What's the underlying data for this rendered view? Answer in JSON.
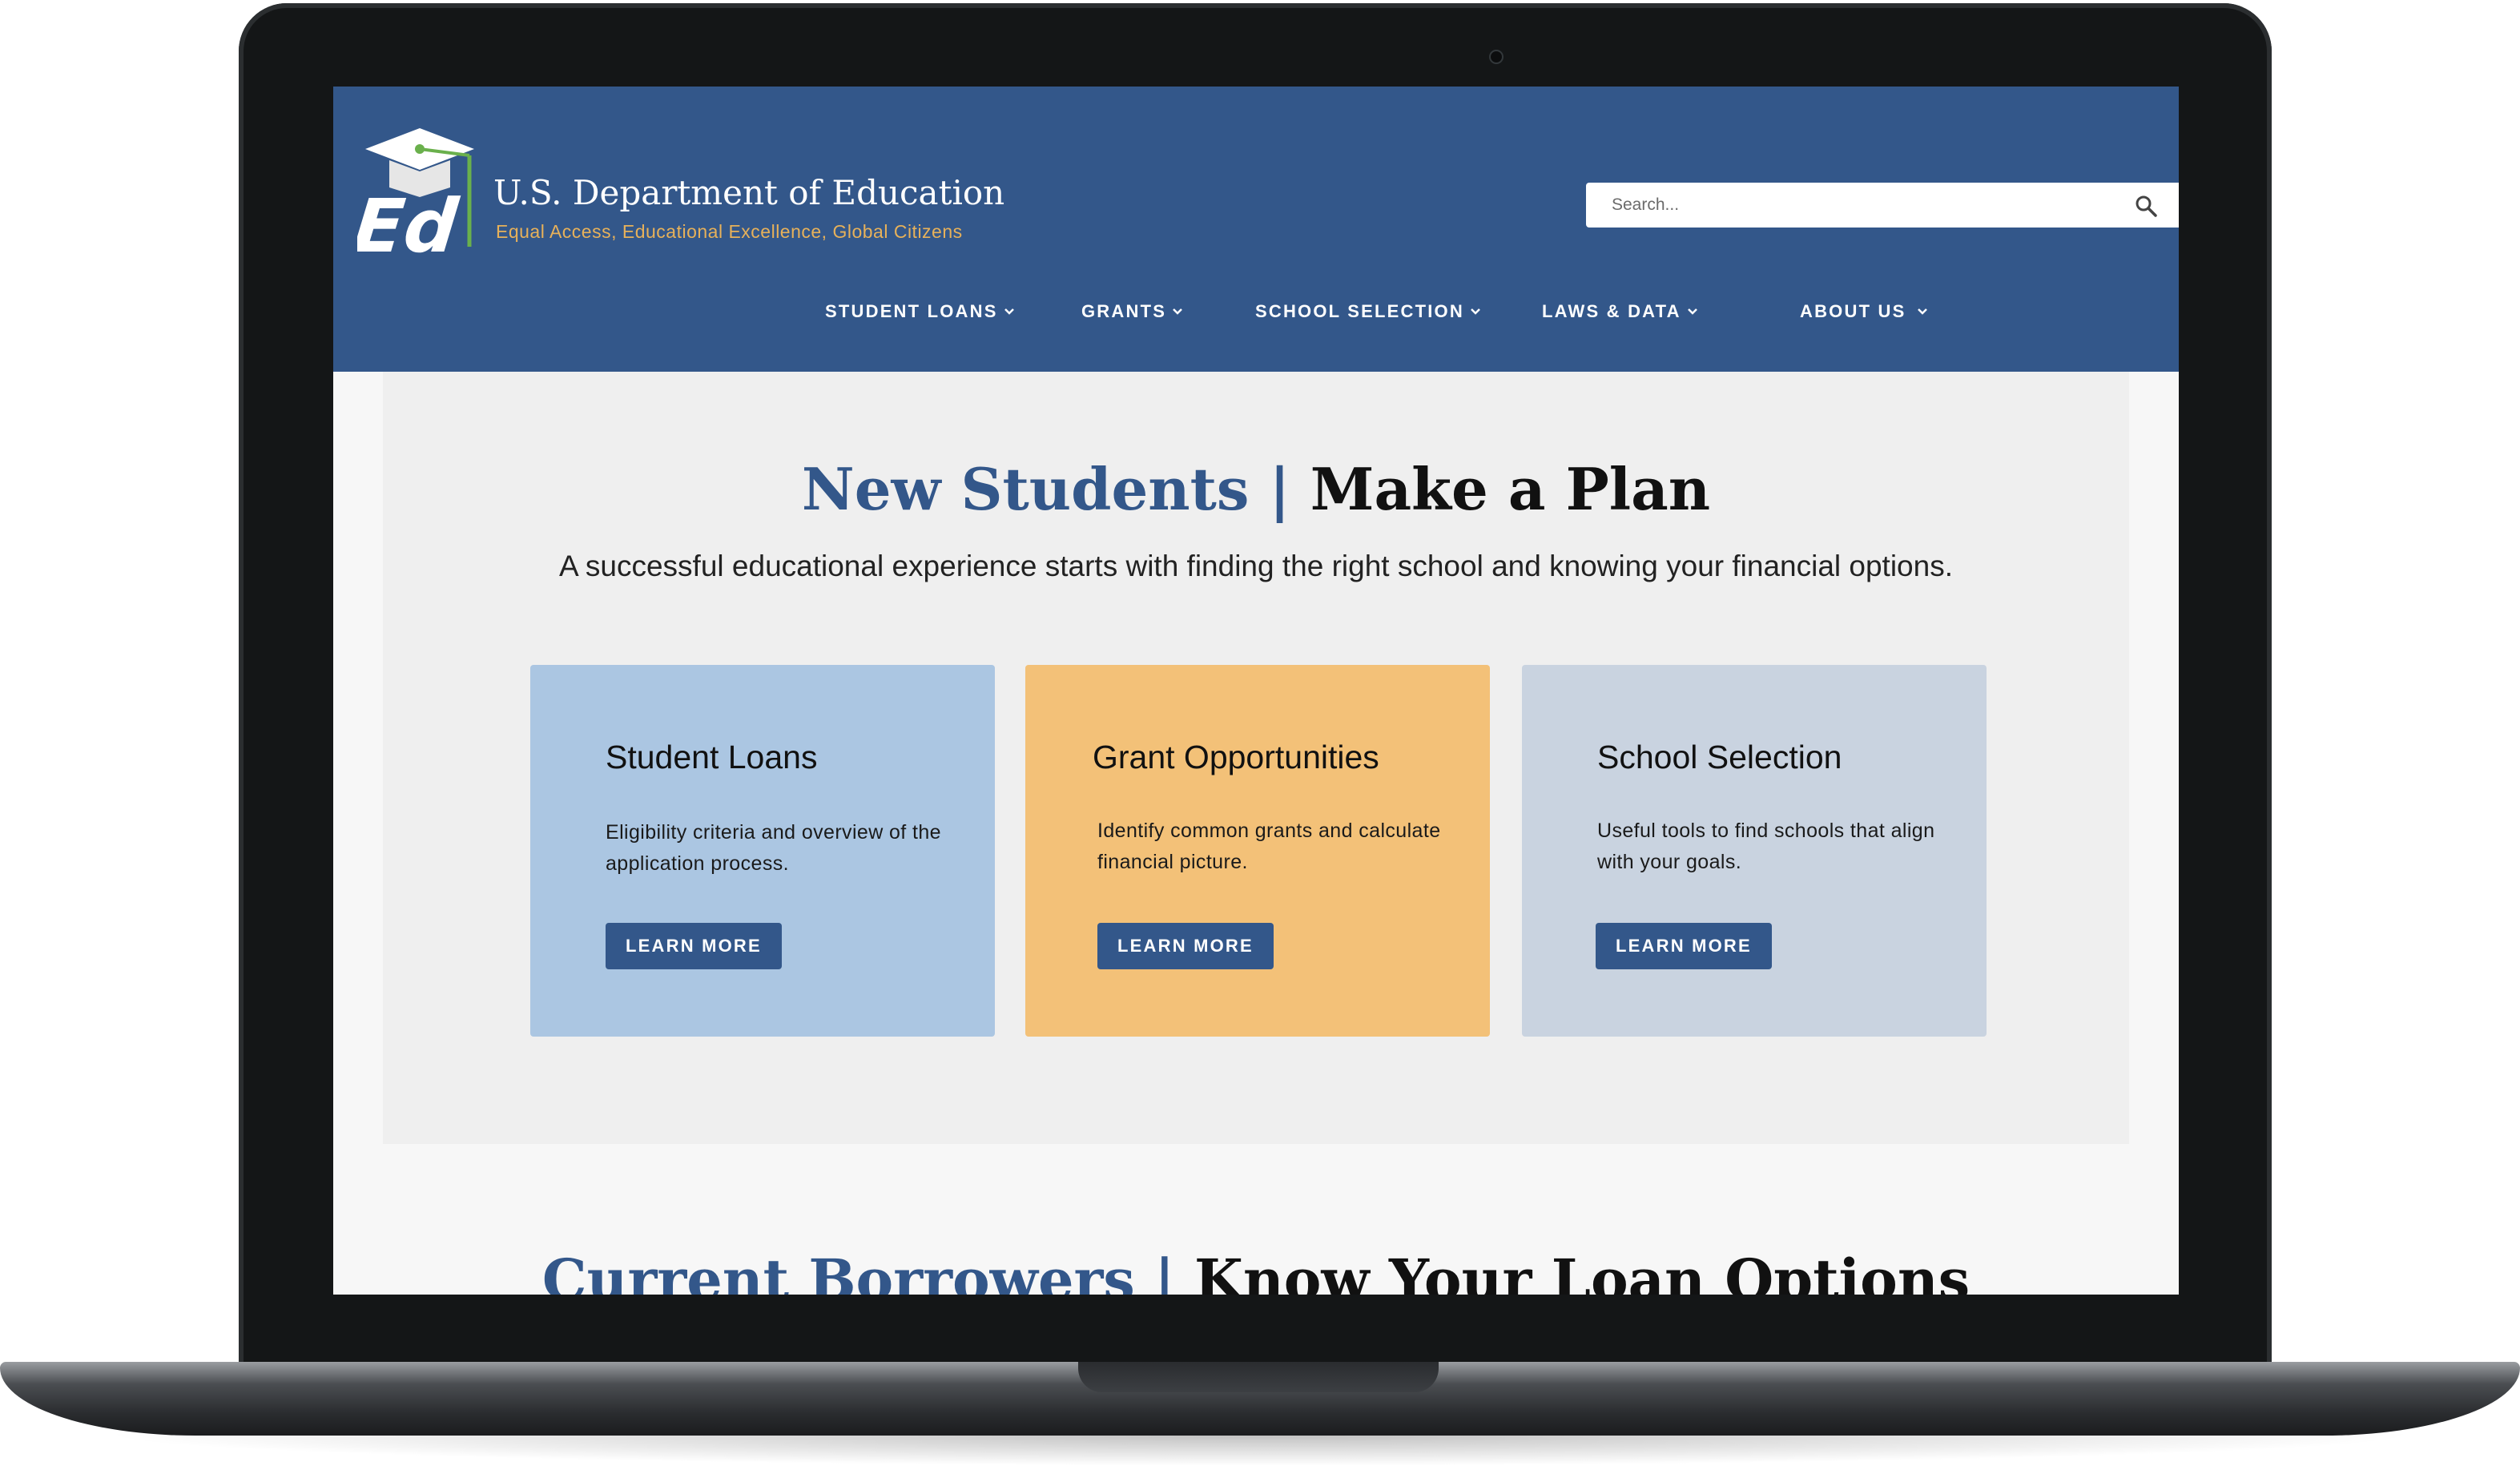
{
  "brand": {
    "title": "U.S. Department of Education",
    "tagline": "Equal Access, Educational Excellence, Global Citizens",
    "logo_letters": "Ed",
    "colors": {
      "primary_blue": "#33578a",
      "accent_gold": "#e7b15a",
      "accent_green": "#6ab04c"
    }
  },
  "search": {
    "placeholder": "Search..."
  },
  "nav": [
    {
      "label": "STUDENT LOANS"
    },
    {
      "label": "GRANTS"
    },
    {
      "label": "SCHOOL SELECTION"
    },
    {
      "label": "LAWS & DATA"
    },
    {
      "label": "ABOUT US"
    }
  ],
  "hero": {
    "title_part1": "New Students |",
    "title_part2": "Make a Plan",
    "subtitle": "A successful educational experience starts with finding the right school and knowing your financial options."
  },
  "cards": [
    {
      "title": "Student Loans",
      "description": "Eligibility criteria and overview of the application process.",
      "button": "LEARN MORE",
      "color": "#abc6e2"
    },
    {
      "title": "Grant Opportunities",
      "description": "Identify common grants and calculate financial picture.",
      "button": "LEARN MORE",
      "color": "#f3c178"
    },
    {
      "title": "School Selection",
      "description": "Useful tools to find schools that align with your goals.",
      "button": "LEARN MORE",
      "color": "#c9d3e0"
    }
  ],
  "section2": {
    "title_part1": "Current Borrowers |",
    "title_part2": "Know Your Loan Options"
  }
}
